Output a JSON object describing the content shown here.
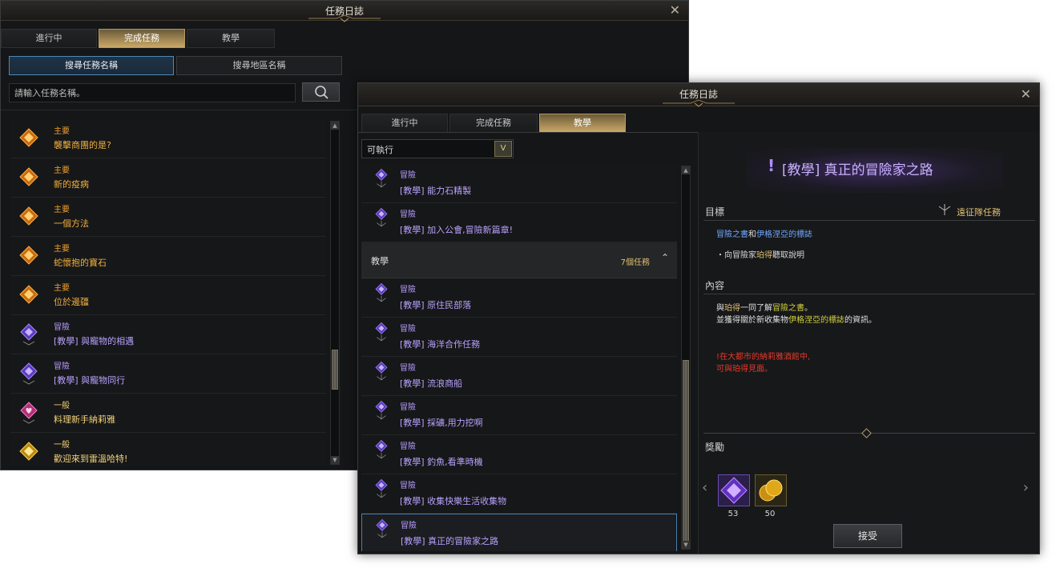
{
  "win1": {
    "title": "任務日誌",
    "tabs": [
      "進行中",
      "完成任務",
      "教學"
    ],
    "subtabs": [
      "搜尋任務名稱",
      "搜尋地區名稱"
    ],
    "search": {
      "placeholder": "請輸入任務名稱。"
    },
    "quests": [
      {
        "cat": "主要",
        "name": "襲擊商團的是?",
        "type": "main"
      },
      {
        "cat": "主要",
        "name": "新的疫病",
        "type": "main"
      },
      {
        "cat": "主要",
        "name": "一個方法",
        "type": "main"
      },
      {
        "cat": "主要",
        "name": "蛇懷抱的寶石",
        "type": "main"
      },
      {
        "cat": "主要",
        "name": "位於邊疆",
        "type": "main"
      },
      {
        "cat": "冒險",
        "name": "[教學] 與寵物的相遇",
        "type": "adv"
      },
      {
        "cat": "冒險",
        "name": "[教學] 與寵物同行",
        "type": "adv"
      },
      {
        "cat": "一般",
        "name": "料理新手納莉雅",
        "type": "gen"
      },
      {
        "cat": "一般",
        "name": "歡迎來到雷溫哈特!",
        "type": "gen2"
      }
    ]
  },
  "win2": {
    "title": "任務日誌",
    "tabs": [
      "進行中",
      "完成任務",
      "教學"
    ],
    "filter": "可執行",
    "quests_top": [
      {
        "cat": "冒險",
        "name": "[教學] 能力石精製"
      },
      {
        "cat": "冒險",
        "name": "[教學] 加入公會,冒險新篇章!"
      }
    ],
    "group": {
      "label": "教學",
      "count": "7個任務"
    },
    "quests": [
      {
        "cat": "冒險",
        "name": "[教學] 原住民部落"
      },
      {
        "cat": "冒險",
        "name": "[教學] 海洋合作任務"
      },
      {
        "cat": "冒險",
        "name": "[教學] 流浪商船"
      },
      {
        "cat": "冒險",
        "name": "[教學] 採礦,用力挖啊"
      },
      {
        "cat": "冒險",
        "name": "[教學] 釣魚,看準時機"
      },
      {
        "cat": "冒險",
        "name": "[教學] 收集快樂生活收集物"
      },
      {
        "cat": "冒險",
        "name": "[教學] 真正的冒險家之路"
      }
    ],
    "detail": {
      "title_mark": "!",
      "title": "[教學] 真正的冒險家之路",
      "goal_label": "目標",
      "expedition": "遠征隊任務",
      "goal_line1_a": "冒險之書",
      "goal_line1_b": "和",
      "goal_line1_c": "伊格涅亞的標誌",
      "goal_line2_a": "・向冒險家",
      "goal_line2_b": "珀得",
      "goal_line2_c": "聽取說明",
      "content_label": "內容",
      "content_l1_a": "與",
      "content_l1_b": "珀得",
      "content_l1_c": "一同了解",
      "content_l1_d": "冒險之書",
      "content_l1_e": "。",
      "content_l2_a": "並獲得關於新收集物",
      "content_l2_b": "伊格涅亞的標誌",
      "content_l2_c": "的資訊。",
      "warn_l1": "!在大都市的納莉雅酒館中,",
      "warn_l2": "可與珀得見面。",
      "reward_label": "獎勵",
      "rewards": [
        {
          "qty": "53"
        },
        {
          "qty": "50"
        }
      ],
      "accept": "接受"
    }
  },
  "colors": {
    "main": "#f0a030",
    "adventure": "#b59cff",
    "general": "#f3d27c",
    "warning": "#e03a2a",
    "highlight_blue": "#5aa0ff",
    "highlight_yellow": "#d8d040"
  }
}
